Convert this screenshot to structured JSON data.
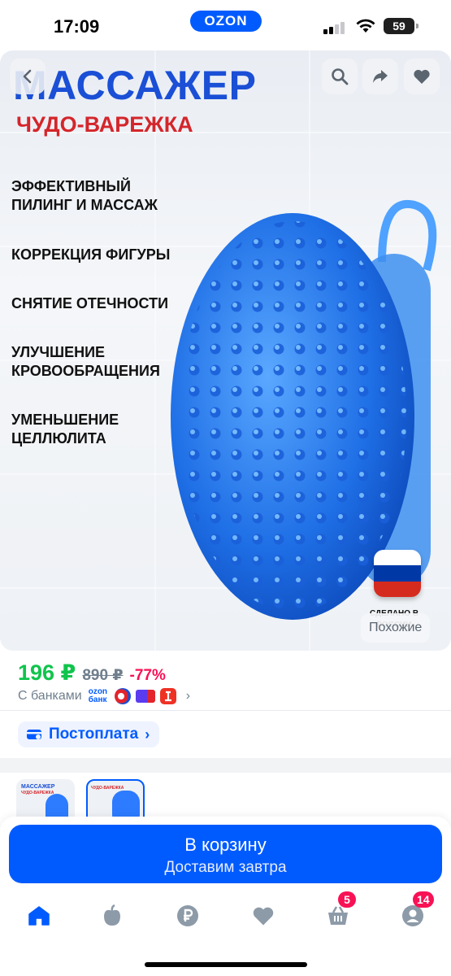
{
  "status_bar": {
    "time": "17:09",
    "app_pill": "OZON",
    "battery": "59"
  },
  "product_image": {
    "title": "МАССАЖЕР",
    "subtitle": "ЧУДО-ВАРЕЖКА",
    "features": [
      "ЭФФЕКТИВНЫЙ\nПИЛИНГ И МАССАЖ",
      "КОРРЕКЦИЯ ФИГУРЫ",
      "СНЯТИЕ ОТЕЧНОСТИ",
      "УЛУЧШЕНИЕ\nКРОВООБРАЩЕНИЯ",
      "УМЕНЬШЕНИЕ\nЦЕЛЛЮЛИТА"
    ],
    "made_in": "СДЕЛАНО\nВ РОССИИ",
    "similar_label": "Похожие",
    "flag_colors": [
      "#ffffff",
      "#0039a6",
      "#d52b1e"
    ]
  },
  "icons": {
    "back": "chevron-left-icon",
    "search": "search-icon",
    "share": "share-icon",
    "favorite": "heart-icon"
  },
  "price": {
    "current": "196 ₽",
    "old": "890 ₽",
    "discount": "-77%",
    "banks_label": "С банками",
    "ozon_bank": "ozon\nбанк"
  },
  "postpay": {
    "label": "Постоплата"
  },
  "cart": {
    "label": "В корзину",
    "sub": "Доставим завтра"
  },
  "tabbar": {
    "items": [
      {
        "name": "home",
        "badge": ""
      },
      {
        "name": "fresh",
        "badge": ""
      },
      {
        "name": "finance",
        "badge": ""
      },
      {
        "name": "favorites",
        "badge": ""
      },
      {
        "name": "cart",
        "badge": "5"
      },
      {
        "name": "profile",
        "badge": "14"
      }
    ]
  },
  "colors": {
    "brand": "#005bff",
    "price": "#10c44c",
    "discount": "#f91155"
  }
}
